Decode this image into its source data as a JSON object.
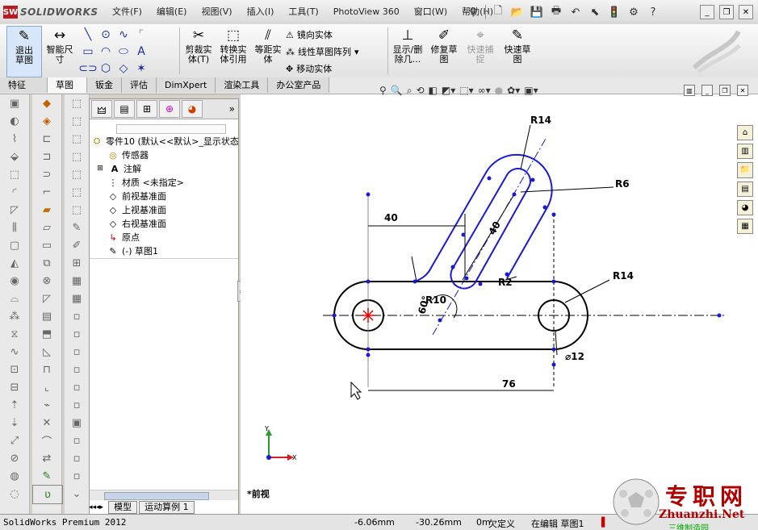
{
  "app": {
    "logo": "SOLIDWORKS",
    "menus": [
      "文件(F)",
      "编辑(E)",
      "视图(V)",
      "插入(I)",
      "工具(T)",
      "PhotoView 360",
      "窗口(W)",
      "帮助(H)"
    ]
  },
  "command_manager": {
    "exit_sketch": "退出草图",
    "smart_dimension": "智能尺寸",
    "trim": "剪裁实体(T)",
    "convert": "转换实体引用",
    "offset": "等距实体",
    "mirror": "镜向实体",
    "linear_pattern": "线性草图阵列",
    "move": "移动实体",
    "display_delete": "显示/删除几...",
    "repair": "修复草图",
    "quick_snap": "快速捕捉",
    "rapid_sketch": "快速草图"
  },
  "tabs": [
    "特征",
    "草图",
    "钣金",
    "评估",
    "DimXpert",
    "渲染工具",
    "办公室产品"
  ],
  "active_tab": "草图",
  "feature_tree": {
    "root": "零件10  (默认<<默认>_显示状态",
    "items": [
      "传感器",
      "注解",
      "材质 <未指定>",
      "前视基准面",
      "上视基准面",
      "右视基准面",
      "原点",
      "(-)  草图1"
    ]
  },
  "bottom_tabs": [
    "模型",
    "运动算例 1"
  ],
  "view_name": "*前视",
  "drawing": {
    "dims": {
      "r14_top": "R14",
      "r6": "R6",
      "d40_h": "40",
      "d40_slot": "40",
      "r2": "R2",
      "r14_right": "R14",
      "r10": "R10",
      "angle": "60°",
      "dia12": "⌀12",
      "d76": "76"
    },
    "triad": {
      "x": "X",
      "y": "Y"
    }
  },
  "status": {
    "product": "SolidWorks Premium 2012",
    "x": "-6.06mm",
    "y": "-30.26mm",
    "z": "0m",
    "state": "欠定义",
    "mode": "在编辑 草图1"
  },
  "watermark": {
    "title": "专职网",
    "url": "Zhuanzhi.Net",
    "sub": "三维制造园"
  },
  "colors": {
    "sketch_blue": "#1a1ad4",
    "sketch_black": "#000000",
    "point_red": "#e00000",
    "accent": "#b81c22"
  }
}
